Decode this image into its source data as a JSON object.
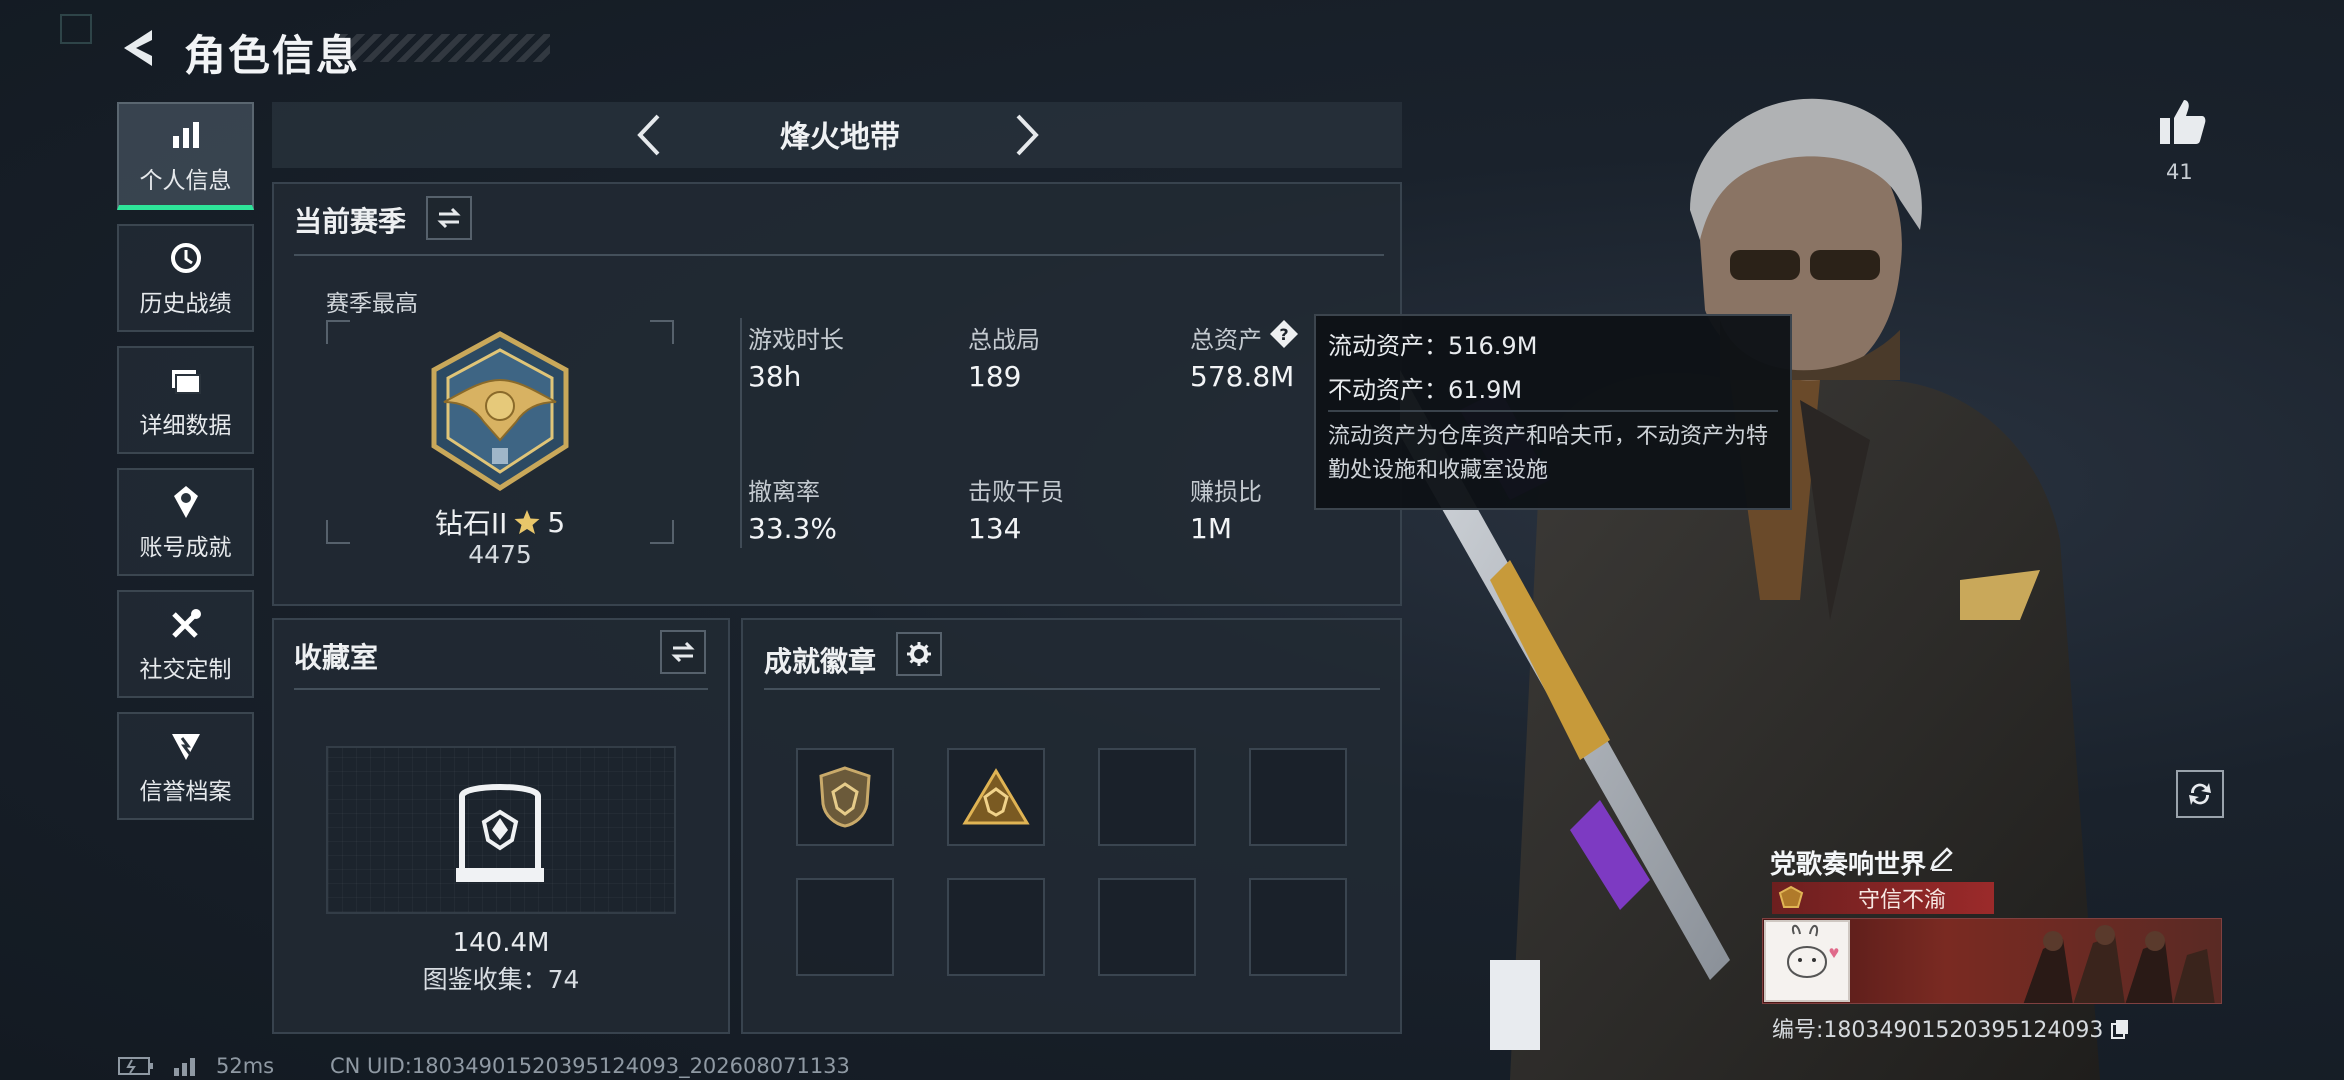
{
  "header": {
    "title": "角色信息"
  },
  "sidebar": {
    "items": [
      {
        "label": "个人信息",
        "icon": "bar-chart-icon",
        "active": true
      },
      {
        "label": "历史战绩",
        "icon": "history-icon",
        "active": false
      },
      {
        "label": "详细数据",
        "icon": "folder-icon",
        "active": false
      },
      {
        "label": "账号成就",
        "icon": "achievement-icon",
        "active": false
      },
      {
        "label": "社交定制",
        "icon": "tools-icon",
        "active": false
      },
      {
        "label": "信誉档案",
        "icon": "reputation-icon",
        "active": false
      }
    ]
  },
  "mode": {
    "title": "烽火地带"
  },
  "season": {
    "title": "当前赛季",
    "best_label": "赛季最高",
    "rank_name": "钻石II",
    "rank_stars": "5",
    "rank_score": "4475",
    "stats": [
      {
        "label": "游戏时长",
        "value": "38h"
      },
      {
        "label": "总战局",
        "value": "189"
      },
      {
        "label": "总资产",
        "value": "578.8M"
      },
      {
        "label": "撤离率",
        "value": "33.3%"
      },
      {
        "label": "击败干员",
        "value": "134"
      },
      {
        "label": "赚损比",
        "value": "1M"
      }
    ]
  },
  "tooltip": {
    "liquid": "流动资产：516.9M",
    "fixed": "不动资产：61.9M",
    "desc": "流动资产为仓库资产和哈夫币，不动资产为特勤处设施和收藏室设施"
  },
  "collection": {
    "title": "收藏室",
    "value": "140.4M",
    "catalog": "图鉴收集：74"
  },
  "achievements": {
    "title": "成就徽章"
  },
  "status": {
    "ping": "52ms",
    "uid": "CN UID:1803490152039512409​3_202608071133"
  },
  "profile": {
    "likes": "41",
    "name": "党歌奏响世界",
    "title_badge": "守信不渝",
    "id": "编号:1803490152039512409​3"
  },
  "colors": {
    "accent": "#2ee59a",
    "badge_red": "#9b2a2a"
  }
}
